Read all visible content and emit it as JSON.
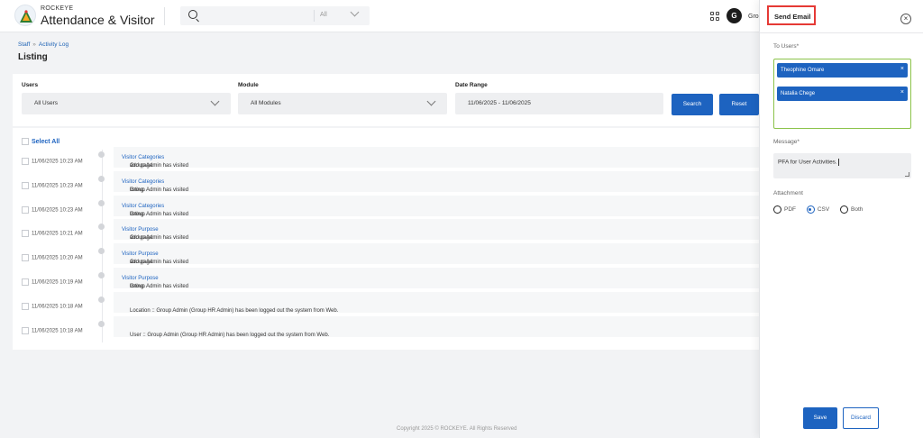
{
  "header": {
    "brand_small": "ROCKEYE",
    "brand_title": "Attendance & Visitor",
    "search_scope": "All",
    "avatar_initial": "G",
    "avatar_name": "Gro"
  },
  "breadcrumb": {
    "parent": "Staff",
    "separator": "»",
    "current": "Activity Log"
  },
  "page_title": "Listing",
  "filters": {
    "users_label": "Users",
    "users_value": "All Users",
    "module_label": "Module",
    "module_value": "All Modules",
    "date_label": "Date Range",
    "date_value": "11/06/2025 - 11/06/2025",
    "search_button": "Search",
    "reset_button": "Reset"
  },
  "list": {
    "select_all": "Select All",
    "rows": [
      {
        "date": "11/06/2025 10:23 AM",
        "pre": "Group Admin has visited ",
        "link": "Visitor Categories",
        "post": " add page."
      },
      {
        "date": "11/06/2025 10:23 AM",
        "pre": "Group Admin has visited ",
        "link": "Visitor Categories",
        "post": " listing."
      },
      {
        "date": "11/06/2025 10:23 AM",
        "pre": "Group Admin has visited ",
        "link": "Visitor Categories",
        "post": " listing."
      },
      {
        "date": "11/06/2025 10:21 AM",
        "pre": "Group Admin has visited ",
        "link": "Visitor Purpose",
        "post": " add page."
      },
      {
        "date": "11/06/2025 10:20 AM",
        "pre": "Group Admin has visited ",
        "link": "Visitor Purpose",
        "post": " add page."
      },
      {
        "date": "11/06/2025 10:19 AM",
        "pre": "Group Admin has visited ",
        "link": "Visitor Purpose",
        "post": " listing."
      },
      {
        "date": "11/06/2025 10:18 AM",
        "pre": "Location :: Group Admin (Group HR Admin) has been logged out the system from Web.",
        "link": "",
        "post": ""
      },
      {
        "date": "11/06/2025 10:18 AM",
        "pre": "User :: Group Admin (Group HR Admin) has been logged out the system from Web.",
        "link": "",
        "post": ""
      }
    ]
  },
  "footer": "Copyright 2025 © ROCKEYE. All Rights Reserved",
  "drawer": {
    "title": "Send Email",
    "to_users_label": "To Users*",
    "users": [
      "Theophine Omare",
      "Natalia Chege"
    ],
    "chip_remove": "×",
    "message_label": "Message*",
    "message_value": "PFA for User Activities.",
    "attachment_label": "Attachment",
    "attachment_options": [
      "PDF",
      "CSV",
      "Both"
    ],
    "attachment_selected": "CSV",
    "save_button": "Save",
    "discard_button": "Discard",
    "close_glyph": "×"
  },
  "colors": {
    "primary": "#1d63c0",
    "highlight_border": "#e53935",
    "valid_border": "#8bc34a"
  }
}
